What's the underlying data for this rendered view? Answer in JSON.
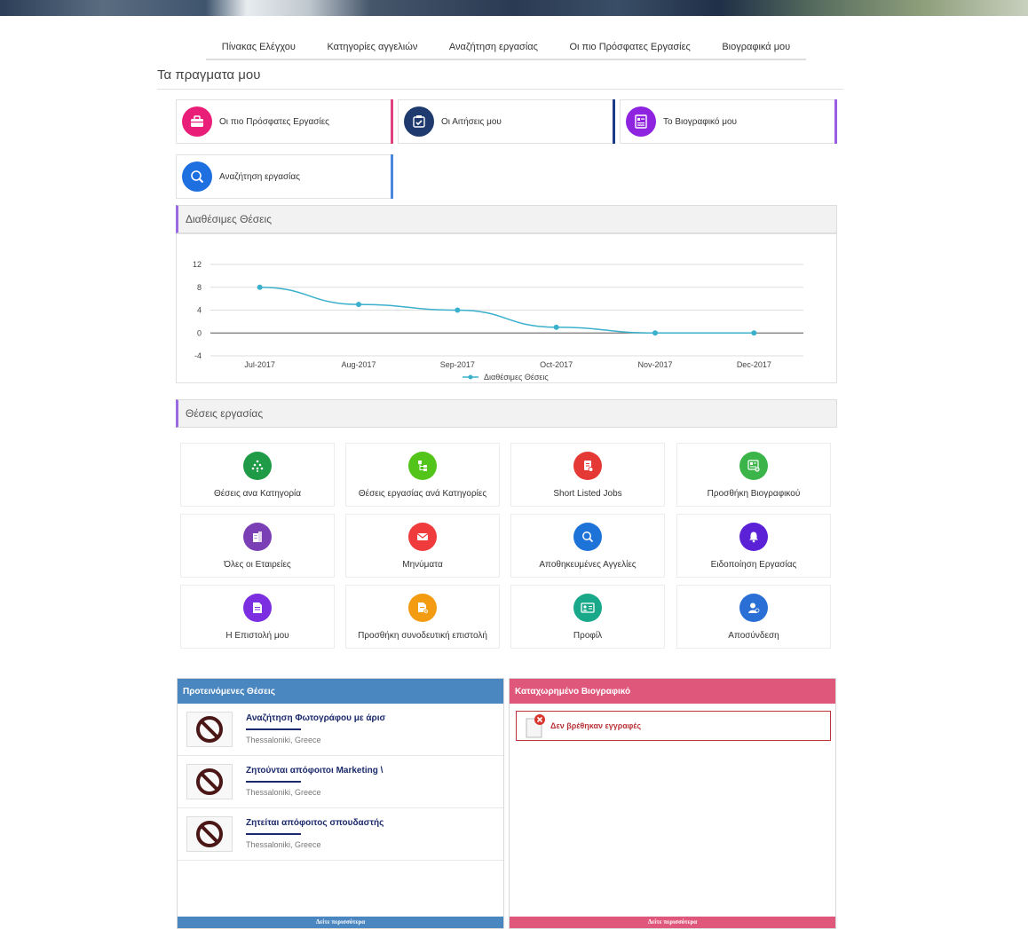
{
  "nav": [
    "Πίνακας Ελέγχου",
    "Κατηγορίες αγγελιών",
    "Αναζήτηση εργασίας",
    "Οι πιο Πρόσφατες Εργασίες",
    "Βιογραφικά μου"
  ],
  "page_title": "Τα πραγματα μου",
  "quick_cards": [
    {
      "label": "Οι πιο Πρόσφατες Εργασίες",
      "icon": "briefcase-icon",
      "color": "#e91e78",
      "bar": "#e0407e"
    },
    {
      "label": "Οι Αιτήσεις μου",
      "icon": "applications-icon",
      "color": "#1e3a6e",
      "bar": "#1e3a8a"
    },
    {
      "label": "Το Βιογραφικό μου",
      "icon": "resume-icon",
      "color": "#8e24e0",
      "bar": "#9b5de5"
    },
    {
      "label": "Αναζήτηση εργασίας",
      "icon": "job-search-icon",
      "color": "#1e6fe0",
      "bar": "#4a88e0"
    }
  ],
  "chart_panel_title": "Διαθέσιμες Θέσεις",
  "chart_data": {
    "type": "line",
    "categories": [
      "Jul-2017",
      "Aug-2017",
      "Sep-2017",
      "Oct-2017",
      "Nov-2017",
      "Dec-2017"
    ],
    "series": [
      {
        "name": "Διαθέσιμες Θέσεις",
        "values": [
          8,
          5,
          4,
          1,
          0,
          0
        ]
      }
    ],
    "ylim": [
      -4,
      12
    ],
    "yticks": [
      "12",
      "8",
      "4",
      "0",
      "-4"
    ],
    "color": "#3ab0cc",
    "legend": "bottom"
  },
  "jobs_panel_title": "Θέσεις εργασίας",
  "tiles": [
    {
      "label": "Θέσεις ανα Κατηγορία",
      "icon": "category-tree-icon",
      "color": "#1f9a46"
    },
    {
      "label": "Θέσεις εργασίας ανά Κατηγορίες",
      "icon": "hierarchy-icon",
      "color": "#52c41a"
    },
    {
      "label": "Short Listed Jobs",
      "icon": "shortlist-icon",
      "color": "#e53935"
    },
    {
      "label": "Προσθήκη Βιογραφικού",
      "icon": "add-resume-icon",
      "color": "#3bb54a"
    },
    {
      "label": "Όλες οι Εταιρείες",
      "icon": "building-icon",
      "color": "#7b3fb5"
    },
    {
      "label": "Μηνύματα",
      "icon": "envelope-icon",
      "color": "#ef3b3b"
    },
    {
      "label": "Αποθηκευμένες Αγγελίες",
      "icon": "saved-search-icon",
      "color": "#1e73d8"
    },
    {
      "label": "Ειδοποίηση Εργασίας",
      "icon": "bell-icon",
      "color": "#5b21d6"
    },
    {
      "label": "Η Επιστολή μου",
      "icon": "letter-icon",
      "color": "#7b2fe0"
    },
    {
      "label": "Προσθήκη συνοδευτική επιστολή",
      "icon": "add-letter-icon",
      "color": "#f39c12"
    },
    {
      "label": "Προφίλ",
      "icon": "profile-card-icon",
      "color": "#1aa88a"
    },
    {
      "label": "Αποσύνδεση",
      "icon": "logout-user-icon",
      "color": "#2a6fd6"
    }
  ],
  "recommended": {
    "title": "Προτεινόμενες Θέσεις",
    "color": "#4a86c0",
    "items": [
      {
        "title": "Αναζήτηση Φωτογράφου με άρισ",
        "location": "Thessaloniki, Greece"
      },
      {
        "title": "Ζητούνται απόφοιτοι Marketing \\",
        "location": "Thessaloniki, Greece"
      },
      {
        "title": "Ζητείται απόφοιτος σπουδαστής",
        "location": "Thessaloniki, Greece"
      }
    ],
    "more": "Δείτε περισσότερα"
  },
  "registered_cv": {
    "title": "Καταχωρημένο Βιογραφικό",
    "color": "#e0577c",
    "empty_text": "Δεν βρέθηκαν εγγραφές",
    "more": "Δείτε περισσότερα"
  }
}
